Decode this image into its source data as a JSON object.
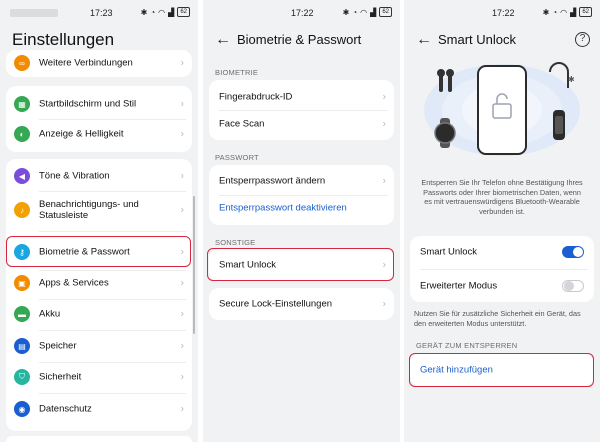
{
  "status_bar": {
    "panel1_time": "17:23",
    "panel2_time": "17:22",
    "panel3_time": "17:22",
    "battery": "62"
  },
  "panel1": {
    "title": "Einstellungen",
    "items": [
      {
        "label": "Weitere Verbindungen",
        "icon": "link-icon",
        "color": "#f28b00"
      },
      {
        "label": "Startbildschirm und Stil",
        "icon": "home-screen-icon",
        "color": "#34a853"
      },
      {
        "label": "Anzeige & Helligkeit",
        "icon": "brightness-icon",
        "color": "#34a853"
      },
      {
        "label": "Töne & Vibration",
        "icon": "volume-icon",
        "color": "#7b4ddb"
      },
      {
        "label": "Benachrichtigungs- und Statusleiste",
        "icon": "bell-icon",
        "color": "#f2a100"
      },
      {
        "label": "Biometrie & Passwort",
        "icon": "key-icon",
        "color": "#1aa7e0"
      },
      {
        "label": "Apps & Services",
        "icon": "apps-icon",
        "color": "#f28b00"
      },
      {
        "label": "Akku",
        "icon": "battery-icon",
        "color": "#34a853"
      },
      {
        "label": "Speicher",
        "icon": "storage-icon",
        "color": "#1a5fd1"
      },
      {
        "label": "Sicherheit",
        "icon": "shield-icon",
        "color": "#28b5a0"
      },
      {
        "label": "Datenschutz",
        "icon": "privacy-icon",
        "color": "#1a5fd1"
      }
    ]
  },
  "panel2": {
    "title": "Biometrie & Passwort",
    "section_biometrie": "BIOMETRIE",
    "fingerprint": "Fingerabdruck-ID",
    "face_scan": "Face Scan",
    "section_passwort": "PASSWORT",
    "change_password": "Entsperrpasswort ändern",
    "disable_password": "Entsperrpasswort deaktivieren",
    "section_sonstige": "SONSTIGE",
    "smart_unlock": "Smart Unlock",
    "secure_lock": "Secure Lock-Einstellungen"
  },
  "panel3": {
    "title": "Smart Unlock",
    "description": "Entsperren Sie Ihr Telefon ohne Bestätigung Ihres Passworts oder Ihrer biometrischen Daten, wenn es mit vertrauenswürdigens Bluetooth-Wearable verbunden ist.",
    "smart_unlock_label": "Smart Unlock",
    "smart_unlock_on": true,
    "advanced_label": "Erweiterter Modus",
    "advanced_on": false,
    "note": "Nutzen Sie für zusätzliche Sicherheit ein Gerät, das den erweiterten Modus unterstützt.",
    "section_device": "GERÄT ZUM ENTSPERREN",
    "add_device": "Gerät hinzufügen"
  },
  "colors": {
    "accent": "#1a5fd1",
    "highlight": "#d7263d"
  }
}
